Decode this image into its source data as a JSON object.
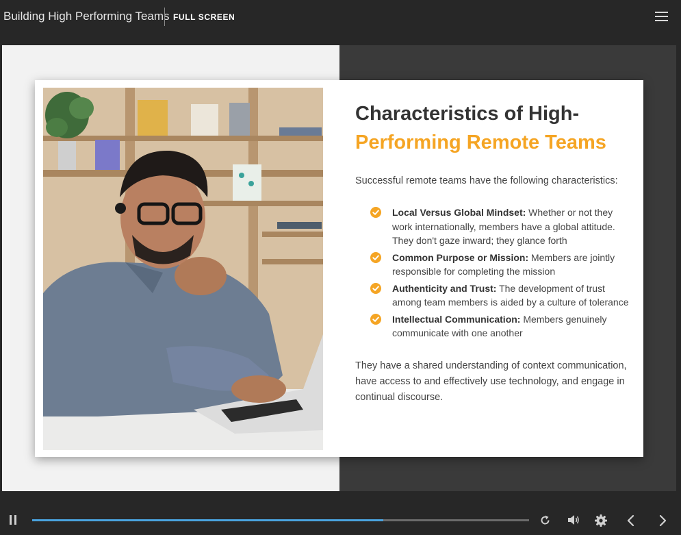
{
  "header": {
    "course_title": "Building High Performing Teams",
    "fullscreen_label": "FULL SCREEN",
    "menu_icon": "hamburger-menu-icon"
  },
  "slide": {
    "heading_line1": "Characteristics of High-",
    "heading_line2": "Performing Remote Teams",
    "intro": "Successful remote teams have the following characteristics:",
    "items": [
      {
        "term": "Local Versus Global Mindset:",
        "desc": " Whether or not they work internationally, members have a global attitude. They don't gaze inward; they glance forth"
      },
      {
        "term": "Common Purpose or Mission:",
        "desc": " Members are jointly responsible for completing the mission"
      },
      {
        "term": "Authenticity and Trust:",
        "desc": " The development of trust among team members is aided by a culture of tolerance"
      },
      {
        "term": "Intellectual Communication:",
        "desc": " Members genuinely communicate with one another"
      }
    ],
    "outro": "They have a shared understanding of context communication, have access to and effectively use technology, and engage in continual discourse.",
    "image": "man-with-headset-using-laptop-photo"
  },
  "player": {
    "progress_fraction": 0.707,
    "icons": [
      "pause-icon",
      "replay-icon",
      "volume-icon",
      "settings-icon",
      "previous-icon",
      "next-icon"
    ]
  },
  "colors": {
    "accent": "#f5a524",
    "progress": "#4aa3df",
    "bar_background": "#272727"
  }
}
